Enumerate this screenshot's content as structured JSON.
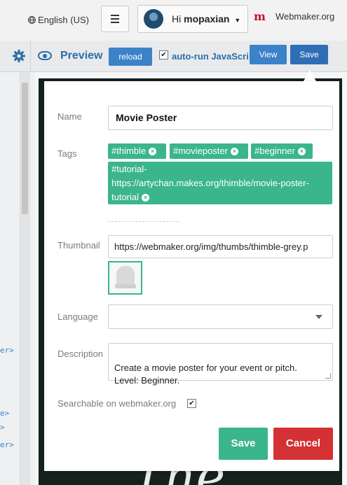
{
  "header": {
    "language": "English (US)",
    "greeting": "Hi",
    "username": "mopaxian",
    "brand_logo": "m",
    "brand": "Webmaker.org"
  },
  "toolbar": {
    "preview_label": "Preview",
    "reload_label": "reload",
    "autorun_label": "auto-run JavaScri",
    "autorun_checked": true,
    "view_label": "View",
    "save_label": "Save"
  },
  "editor": {
    "code_lines": [
      "er>",
      "e>",
      ">",
      "er>"
    ]
  },
  "preview": {
    "big_text": "The"
  },
  "publish": {
    "name_label": "Name",
    "name_value": "Movie Poster",
    "tags_label": "Tags",
    "tags": [
      "#thimble",
      "#movieposter",
      "#beginner",
      "#tutorial-https://artychan.makes.org/thimble/movie-poster-tutorial"
    ],
    "tag_long_lines": [
      "#tutorial-",
      "https://artychan.makes.org/thimble/movie-poster-",
      "tutorial"
    ],
    "thumbnail_label": "Thumbnail",
    "thumbnail_value": "https://webmaker.org/img/thumbs/thimble-grey.p",
    "language_label": "Language",
    "language_value": "",
    "description_label": "Description",
    "description_value": "Create a movie poster for your event or pitch.\nLevel: Beginner.",
    "searchable_label": "Searchable on webmaker.org",
    "searchable_checked": true,
    "save_label": "Save",
    "cancel_label": "Cancel"
  },
  "colors": {
    "accent_blue": "#3b82c9",
    "tag_green": "#3bb58b",
    "cancel_red": "#d43134"
  },
  "icons": [
    "globe-icon",
    "menu-icon",
    "gear-icon",
    "eye-icon",
    "remove-tag-icon",
    "chevron-down-icon",
    "check-icon"
  ]
}
